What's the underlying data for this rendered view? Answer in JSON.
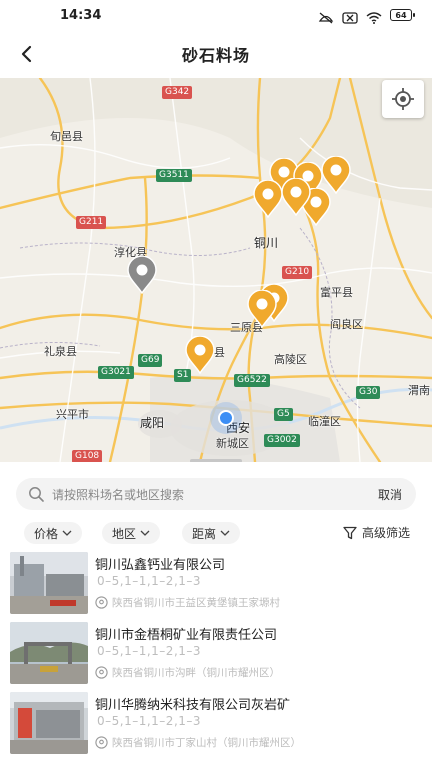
{
  "status_bar": {
    "time": "14:34",
    "battery": "64"
  },
  "header": {
    "title": "砂石料场"
  },
  "map": {
    "places": {
      "xunyi": "旬邑县",
      "chunhua": "淳化县",
      "tongchuan": "铜川",
      "fuping": "富平县",
      "yanliang": "阎良区",
      "sanyuan": "三原县",
      "liquan": "礼泉县",
      "county_suffix": "县",
      "gaoling": "高陵区",
      "xianyang": "咸阳",
      "xingping": "兴平市",
      "xian": "西安",
      "xincheng": "新城区",
      "lintong": "临潼区",
      "weinan": "渭南"
    },
    "roads": {
      "g342": "G342",
      "g3511": "G3511",
      "g211": "G211",
      "g210": "G210",
      "g69": "G69",
      "g3021": "G3021",
      "s1": "S1",
      "g6522": "G6522",
      "g30": "G30",
      "g5": "G5",
      "g3002": "G3002",
      "g108": "G108"
    }
  },
  "search": {
    "placeholder": "请按照料场名或地区搜索",
    "cancel": "取消"
  },
  "filters": [
    {
      "label": "价格"
    },
    {
      "label": "地区"
    },
    {
      "label": "距离"
    }
  ],
  "advanced_filter": "高级筛选",
  "results": [
    {
      "name": "铜川弘鑫钙业有限公司",
      "spec": "0–5,1–1,1–2,1–3",
      "address": "陕西省铜川市王益区黄堡镇王家塬村"
    },
    {
      "name": "铜川市金梧桐矿业有限责任公司",
      "spec": "0–5,1–1,1–2,1–3",
      "address": "陕西省铜川市沟畔（铜川市耀州区）"
    },
    {
      "name": "铜川华腾纳米科技有限公司灰岩矿",
      "spec": "0–5,1–1,1–2,1–3",
      "address": "陕西省铜川市丁家山村（铜川市耀州区）"
    }
  ],
  "colors": {
    "pin": "#f0a92d",
    "pin_inactive": "#8a8a8a",
    "accent": "#3c8ef5"
  }
}
